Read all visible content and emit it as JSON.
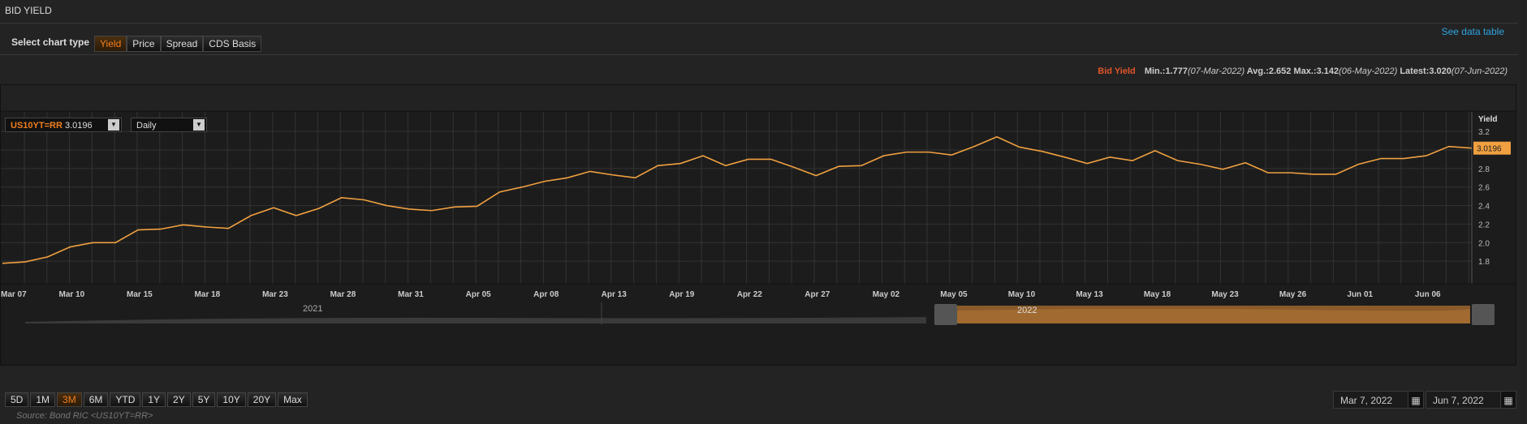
{
  "title": "BID YIELD",
  "chart_type": {
    "label": "Select chart type",
    "options": [
      "Yield",
      "Price",
      "Spread",
      "CDS Basis"
    ],
    "selected": "Yield"
  },
  "see_data_table": "See data table",
  "stats": {
    "label": "Bid Yield",
    "min": "Min.:1.777",
    "min_date": "(07-Mar-2022)",
    "avg": "Avg.:2.652",
    "max": "Max.:3.142",
    "max_date": "(06-May-2022)",
    "latest": "Latest:3.020",
    "latest_date": "(07-Jun-2022)"
  },
  "instrument": {
    "ric": "US10YT=RR",
    "value": "3.0196",
    "interval": "Daily"
  },
  "colors": {
    "line": "#f0a040",
    "accent": "#f07f1d",
    "link": "#2fa4e0"
  },
  "chart_data": {
    "type": "line",
    "ylabel": "Yield",
    "ylim": [
      1.6,
      3.35
    ],
    "yticks": [
      "1.8",
      "2.0",
      "2.2",
      "2.4",
      "2.6",
      "2.8",
      "3.0",
      "3.2"
    ],
    "ytick_values": [
      1.8,
      2.0,
      2.2,
      2.4,
      2.6,
      2.8,
      3.0,
      3.2
    ],
    "last_value_label": "3.0196",
    "xtick_labels": [
      "Mar 07",
      "Mar 10",
      "Mar 15",
      "Mar 18",
      "Mar 23",
      "Mar 28",
      "Mar 31",
      "Apr 05",
      "Apr 08",
      "Apr 13",
      "Apr 19",
      "Apr 22",
      "Apr 27",
      "May 02",
      "May 05",
      "May 10",
      "May 13",
      "May 18",
      "May 23",
      "May 26",
      "Jun 01",
      "Jun 06"
    ],
    "xtick_index_step": 3,
    "series": [
      {
        "name": "US10YT=RR",
        "values": [
          1.777,
          1.792,
          1.846,
          1.954,
          2.0,
          2.0,
          2.138,
          2.146,
          2.192,
          2.169,
          2.154,
          2.292,
          2.377,
          2.292,
          2.369,
          2.485,
          2.462,
          2.4,
          2.362,
          2.346,
          2.385,
          2.392,
          2.546,
          2.6,
          2.662,
          2.7,
          2.769,
          2.731,
          2.7,
          2.831,
          2.854,
          2.938,
          2.831,
          2.9,
          2.9,
          2.815,
          2.723,
          2.823,
          2.831,
          2.938,
          2.977,
          2.977,
          2.946,
          3.038,
          3.142,
          3.031,
          2.985,
          2.923,
          2.854,
          2.923,
          2.885,
          2.992,
          2.885,
          2.846,
          2.792,
          2.862,
          2.754,
          2.754,
          2.738,
          2.738,
          2.846,
          2.908,
          2.908,
          2.938,
          3.038,
          3.02
        ]
      }
    ]
  },
  "navigator": {
    "year_labels": [
      "2021",
      "2022"
    ]
  },
  "ranges": [
    "5D",
    "1M",
    "3M",
    "6M",
    "YTD",
    "1Y",
    "2Y",
    "5Y",
    "10Y",
    "20Y",
    "Max"
  ],
  "range_selected": "3M",
  "dates": {
    "from": "Mar 7, 2022",
    "to": "Jun 7, 2022"
  },
  "source": "Source: Bond RIC <US10YT=RR>"
}
